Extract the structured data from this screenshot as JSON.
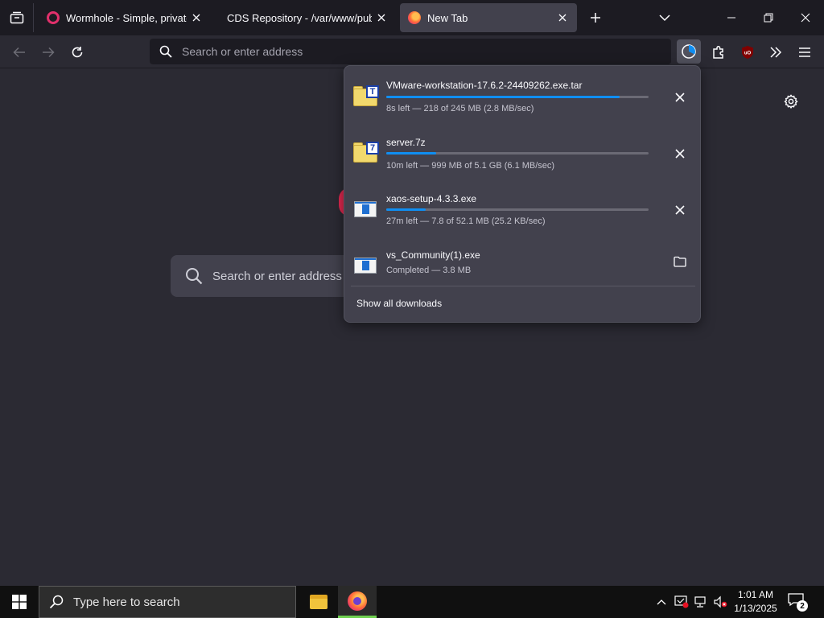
{
  "browser": {
    "tabs": [
      {
        "title": "Wormhole - Simple, private file",
        "favicon": "wormhole-icon",
        "active": false
      },
      {
        "title": "CDS Repository - /var/www/public",
        "favicon": "",
        "active": false
      },
      {
        "title": "New Tab",
        "favicon": "firefox-icon",
        "active": true
      }
    ],
    "address_placeholder": "Search or enter address"
  },
  "newtab": {
    "search_placeholder": "Search or enter address"
  },
  "downloads": {
    "items": [
      {
        "name": "VMware-workstation-17.6.2-24409262.exe.tar",
        "status": "8s left — 218 of 245 MB (2.8 MB/sec)",
        "progress": 0.89,
        "icon": "archive-icon",
        "badge": "T",
        "action": "cancel"
      },
      {
        "name": "server.7z",
        "status": "10m left — 999 MB of 5.1 GB (6.1 MB/sec)",
        "progress": 0.19,
        "icon": "archive-icon",
        "badge": "7",
        "action": "cancel"
      },
      {
        "name": "xaos-setup-4.3.3.exe",
        "status": "27m left — 7.8 of 52.1 MB (25.2 KB/sec)",
        "progress": 0.15,
        "icon": "exe-icon",
        "badge": "",
        "action": "cancel"
      },
      {
        "name": "vs_Community(1).exe",
        "status": "Completed — 3.8 MB",
        "progress": 1.0,
        "icon": "exe-icon",
        "badge": "",
        "action": "open-folder"
      }
    ],
    "show_all_label": "Show all downloads"
  },
  "taskbar": {
    "search_placeholder": "Type here to search",
    "time": "1:01 AM",
    "date": "1/13/2025",
    "notification_count": "2"
  },
  "colors": {
    "accent": "#0f8ef2",
    "background": "#2b2a33",
    "panel": "#42414d"
  }
}
